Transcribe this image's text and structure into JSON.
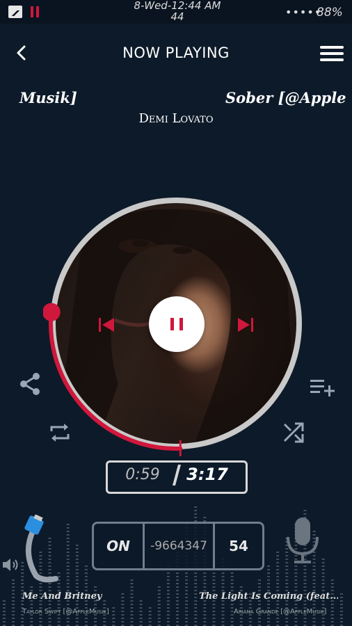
{
  "status_bar": {
    "time": "8-Wed-12:44 AM",
    "time_line2": "44",
    "signal_dots": "•••••",
    "battery": "88%"
  },
  "header": {
    "title": "NOW PLAYING",
    "back_icon": "chevron-left-icon",
    "menu_icon": "hamburger-menu-icon"
  },
  "now_playing": {
    "song_marquee_left": "Musik]",
    "song_marquee_right": "Sober [@Apple",
    "artist": "Demi Lovato",
    "elapsed": "0:59",
    "duration": "3:17",
    "progress": 0.3
  },
  "controls": {
    "pause_icon": "pause-icon",
    "prev_icon": "skip-previous-icon",
    "next_icon": "skip-next-icon",
    "share_icon": "share-icon",
    "queue_add_icon": "playlist-add-icon",
    "repeat_icon": "repeat-icon",
    "shuffle_icon": "shuffle-icon"
  },
  "radio_panel": {
    "on_label": "ON",
    "frequency": "-9664347",
    "level": "54"
  },
  "bottom_tracks": {
    "left_title": "Me And Britney",
    "left_artist": "Taylor Swift [@AppleMusik]",
    "right_title": "The Light Is Coming (feat...",
    "right_artist": "Ariana Grande [@AppleMusik]"
  },
  "colors": {
    "accent": "#d0173c",
    "background": "#0d1a29"
  }
}
